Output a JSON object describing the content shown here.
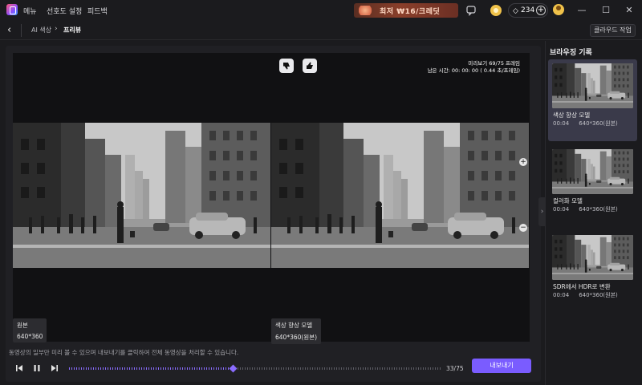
{
  "titlebar": {
    "menu_items": [
      "메뉴",
      "선호도 설정",
      "피드백"
    ],
    "promo_banner": "최저 ₩16/크레딧",
    "credits": "234",
    "window_controls": [
      "minimize-icon",
      "maximize-icon",
      "close-icon"
    ]
  },
  "nav": {
    "breadcrumb_parent": "AI 색상",
    "breadcrumb_current": "프리뷰",
    "cloud_button": "클라우드 작업"
  },
  "viewer": {
    "info_line1": "미리보기 69/75 프레임",
    "info_line2": "남은 시간: 00: 00: 00 ( 0.44 초/프레임)",
    "left_label": "원본",
    "left_size": "640*360",
    "right_label": "색상 향상 모델",
    "right_size": "640*360(원본)"
  },
  "hint": "동영상의 일부만 미리 볼 수 있으며 내보내기를 클릭하여 전체 동영상을 처리할 수 있습니다.",
  "player": {
    "current_frame": 33,
    "total_frames": 75,
    "counter": "33/75",
    "export_label": "내보내기"
  },
  "sidebar": {
    "title": "브라우징 기록",
    "items": [
      {
        "name": "색상 향상 모델",
        "duration": "00:04",
        "size": "640*360(원본)",
        "active": true
      },
      {
        "name": "컬러화 모델",
        "duration": "00:04",
        "size": "640*360(원본)",
        "active": false
      },
      {
        "name": "SDR에서 HDR로 변환",
        "duration": "00:04",
        "size": "640*360(원본)",
        "active": false
      }
    ]
  },
  "colors": {
    "accent": "#7a5cff",
    "background": "#1b1b1e",
    "panel": "#202024",
    "active_card": "#3a3a4a"
  }
}
